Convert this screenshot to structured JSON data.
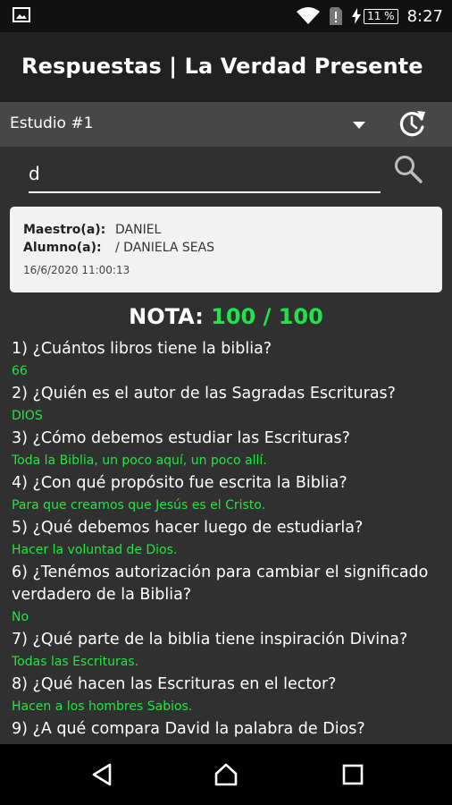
{
  "status_bar": {
    "time": "8:27",
    "battery": "11 %",
    "icons": [
      "image-icon",
      "wifi-icon",
      "sim-icon",
      "charging-icon",
      "battery-icon"
    ]
  },
  "app_bar": {
    "title": "Respuestas | La Verdad Presente"
  },
  "toolbar": {
    "selected_study": "Estudio #1"
  },
  "search": {
    "value": "d"
  },
  "card": {
    "maestro_label": "Maestro(a):",
    "maestro_value": "DANIEL",
    "alumno_label": "Alumno(a):",
    "alumno_value": "/ DANIELA SEAS",
    "date": "16/6/2020 11:00:13"
  },
  "score": {
    "label": "NOTA:",
    "value": "100 / 100"
  },
  "questions": [
    {
      "q": "1) ¿Cuántos libros tiene la biblia?",
      "a": "66"
    },
    {
      "q": "2) ¿Quién es el autor de las Sagradas Escrituras?",
      "a": "DIOS"
    },
    {
      "q": "3) ¿Cómo debemos estudiar las Escrituras?",
      "a": "Toda la Biblia, un poco aquí, un poco allí."
    },
    {
      "q": "4) ¿Con qué propósito fue escrita la Biblia?",
      "a": "Para que creamos que Jesús es el Cristo."
    },
    {
      "q": "5) ¿Qué debemos hacer luego de estudiarla?",
      "a": "Hacer la voluntad de Dios."
    },
    {
      "q": "6) ¿Tenémos autorización para cambiar el significado verdadero de la Biblia?",
      "a": "No"
    },
    {
      "q": "7) ¿Qué parte de la biblia tiene inspiración Divina?",
      "a": "Todas las Escrituras."
    },
    {
      "q": "8) ¿Qué hacen las Escrituras en el lector?",
      "a": "Hacen a los hombres Sabios."
    },
    {
      "q": "9) ¿A qué compara David la palabra de Dios?",
      "a": ""
    }
  ],
  "colors": {
    "answer_green": "#1fe83f",
    "score_green": "#22e34b",
    "background": "#303030",
    "app_bar": "#212121"
  }
}
